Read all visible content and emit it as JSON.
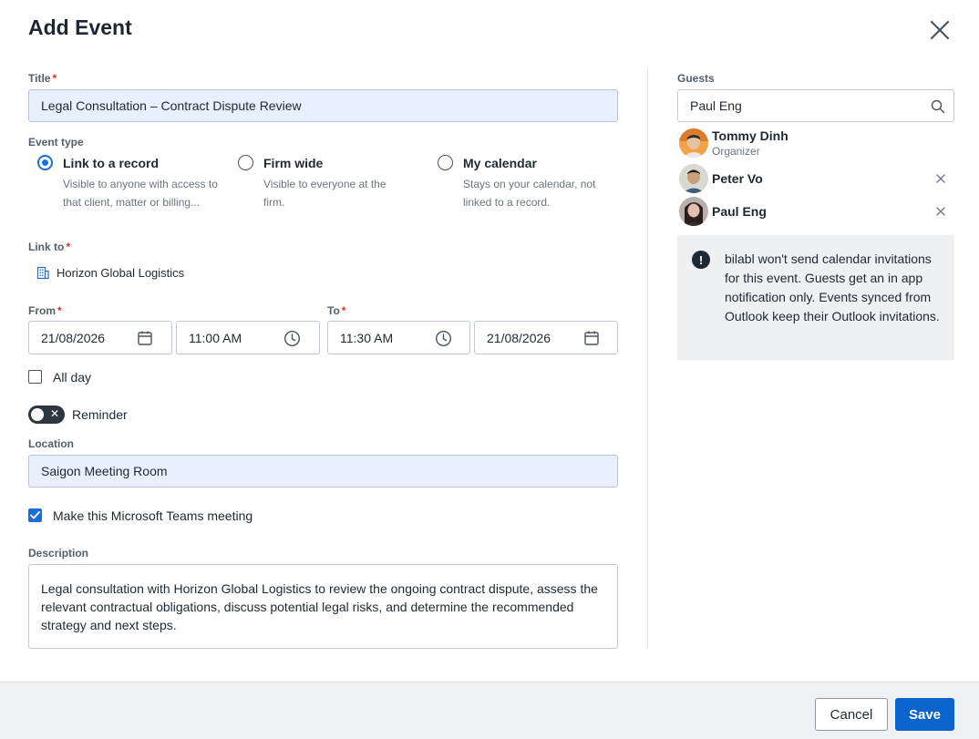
{
  "dialog": {
    "title": "Add Event"
  },
  "title_field": {
    "label": "Title",
    "value": "Legal Consultation – Contract Dispute Review"
  },
  "event_type": {
    "label": "Event type",
    "options": [
      {
        "title": "Link to a record",
        "desc": "Visible to anyone with access to that client, matter or billing...",
        "checked": true
      },
      {
        "title": "Firm wide",
        "desc": "Visible to everyone at the firm.",
        "checked": false
      },
      {
        "title": "My calendar",
        "desc": "Stays on your calendar, not linked to a record.",
        "checked": false
      }
    ]
  },
  "link_to": {
    "label": "Link to",
    "value": "Horizon Global Logistics"
  },
  "from": {
    "label": "From",
    "date": "21/08/2026",
    "time": "11:00 AM"
  },
  "to": {
    "label": "To",
    "time": "11:30 AM",
    "date": "21/08/2026"
  },
  "all_day": {
    "label": "All day",
    "checked": false
  },
  "reminder": {
    "label": "Reminder",
    "on": false
  },
  "location": {
    "label": "Location",
    "value": "Saigon Meeting Room"
  },
  "teams": {
    "label": "Make this Microsoft Teams meeting",
    "checked": true
  },
  "description": {
    "label": "Description",
    "value": "Legal consultation with Horizon Global Logistics to review the ongoing contract dispute, assess the relevant contractual obligations, discuss potential legal risks, and determine the recommended strategy and next steps."
  },
  "guests": {
    "label": "Guests",
    "search_value": "Paul Eng",
    "list": [
      {
        "name": "Tommy Dinh",
        "role": "Organizer"
      },
      {
        "name": "Peter Vo",
        "role": ""
      },
      {
        "name": "Paul Eng",
        "role": ""
      }
    ]
  },
  "notice": {
    "text": "bilabl won't send calendar invitations for this event. Guests get an in app notification only. Events synced from Outlook keep their Outlook invitations."
  },
  "footer": {
    "cancel_label": "Cancel",
    "save_label": "Save"
  },
  "colors": {
    "accent": "#0b63ce",
    "required": "#d93025",
    "filled_input": "#e9f0fd"
  }
}
